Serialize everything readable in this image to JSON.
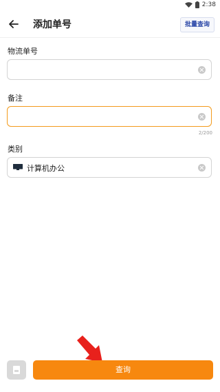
{
  "status_bar": {
    "time": "2:38"
  },
  "header": {
    "title": "添加单号",
    "batch_label": "批量查询"
  },
  "form": {
    "tracking": {
      "label": "物流单号",
      "value": ""
    },
    "note": {
      "label": "备注",
      "value": "",
      "counter": "2/200"
    },
    "category": {
      "label": "类别",
      "value": "计算机办公",
      "icon": "monitor-icon"
    }
  },
  "footer": {
    "query_label": "查询"
  },
  "colors": {
    "accent": "#f7880f",
    "active_border": "#f39a1a",
    "link_blue": "#2c48a8",
    "arrow": "#e8211c"
  }
}
